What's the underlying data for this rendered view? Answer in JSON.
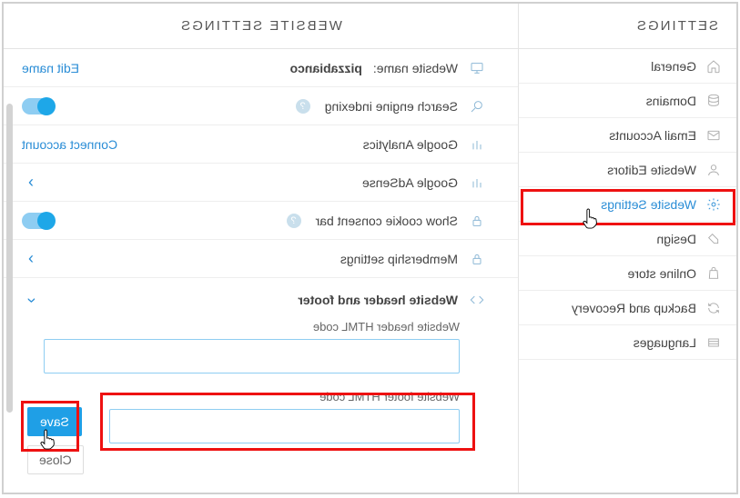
{
  "sidebar": {
    "title": "SETTINGS",
    "items": [
      {
        "label": "General"
      },
      {
        "label": "Domains"
      },
      {
        "label": "Email Accounts"
      },
      {
        "label": "Website Editors"
      },
      {
        "label": "Website Settings"
      },
      {
        "label": "Design"
      },
      {
        "label": "Online store"
      },
      {
        "label": "Backup and Recovery"
      },
      {
        "label": "Languages"
      }
    ]
  },
  "main": {
    "title": "WEBSITE SETTINGS",
    "website_name_label": "Website name:",
    "website_name_value": "pizzabianco",
    "edit_name_action": "Edit name",
    "search_engine_label": "Search engine indexing",
    "analytics_label": "Google Analytics",
    "connect_account_action": "Connect account",
    "adsense_label": "Google AdSense",
    "cookie_label": "Show cookie consent bar",
    "membership_label": "Membership settings",
    "header_footer_label": "Website header and footer",
    "header_code_label": "Website header HTML code",
    "footer_code_label": "Website footer HTML code",
    "header_code_value": "",
    "footer_code_value": ""
  },
  "actions": {
    "save": "Save",
    "close": "Close"
  }
}
